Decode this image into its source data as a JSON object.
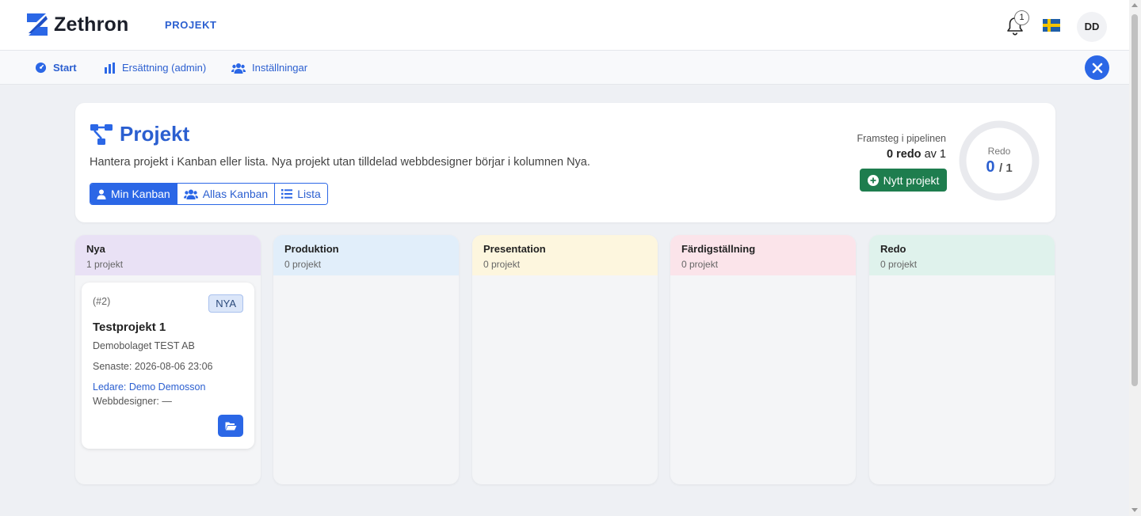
{
  "app": {
    "brand": "Zethron",
    "section": "PROJEKT",
    "notification_count": "1",
    "user_initials": "DD"
  },
  "nav": {
    "items": [
      {
        "label": "Start",
        "icon": "gauge-icon"
      },
      {
        "label": "Ersättning (admin)",
        "icon": "bar-chart-icon"
      },
      {
        "label": "Inställningar",
        "icon": "users-gear-icon"
      }
    ]
  },
  "header": {
    "title": "Projekt",
    "description": "Hantera projekt i Kanban eller lista. Nya projekt utan tilldelad webbdesigner börjar i kolumnen Nya.",
    "views": [
      "Min Kanban",
      "Allas Kanban",
      "Lista"
    ],
    "active_view": "Min Kanban",
    "pipeline_label": "Framsteg i pipelinen",
    "done_count": "0",
    "done_word": "redo",
    "of_word": "av",
    "total_count": "1",
    "new_button": "Nytt projekt",
    "donut_label": "Redo",
    "donut_done": "0",
    "donut_total": "/ 1",
    "progress_fraction": 0
  },
  "columns": [
    {
      "title": "Nya",
      "count": "1 projekt",
      "color": "#e9e1f5"
    },
    {
      "title": "Produktion",
      "count": "0 projekt",
      "color": "#e1eefa"
    },
    {
      "title": "Presentation",
      "count": "0 projekt",
      "color": "#fdf6de"
    },
    {
      "title": "Färdigställning",
      "count": "0 projekt",
      "color": "#fbe4ea"
    },
    {
      "title": "Redo",
      "count": "0 projekt",
      "color": "#dff2ec"
    }
  ],
  "cards": [
    {
      "id": "(#2)",
      "badge": "NYA",
      "title": "Testprojekt 1",
      "company": "Demobolaget TEST AB",
      "latest": "Senaste: 2026-08-06 23:06",
      "lead": "Ledare: Demo Demosson",
      "designer": "Webbdesigner: —"
    }
  ],
  "colors": {
    "accent": "#2b67e6",
    "brand_text": "#2b5fd0",
    "success": "#1e7d4e"
  }
}
